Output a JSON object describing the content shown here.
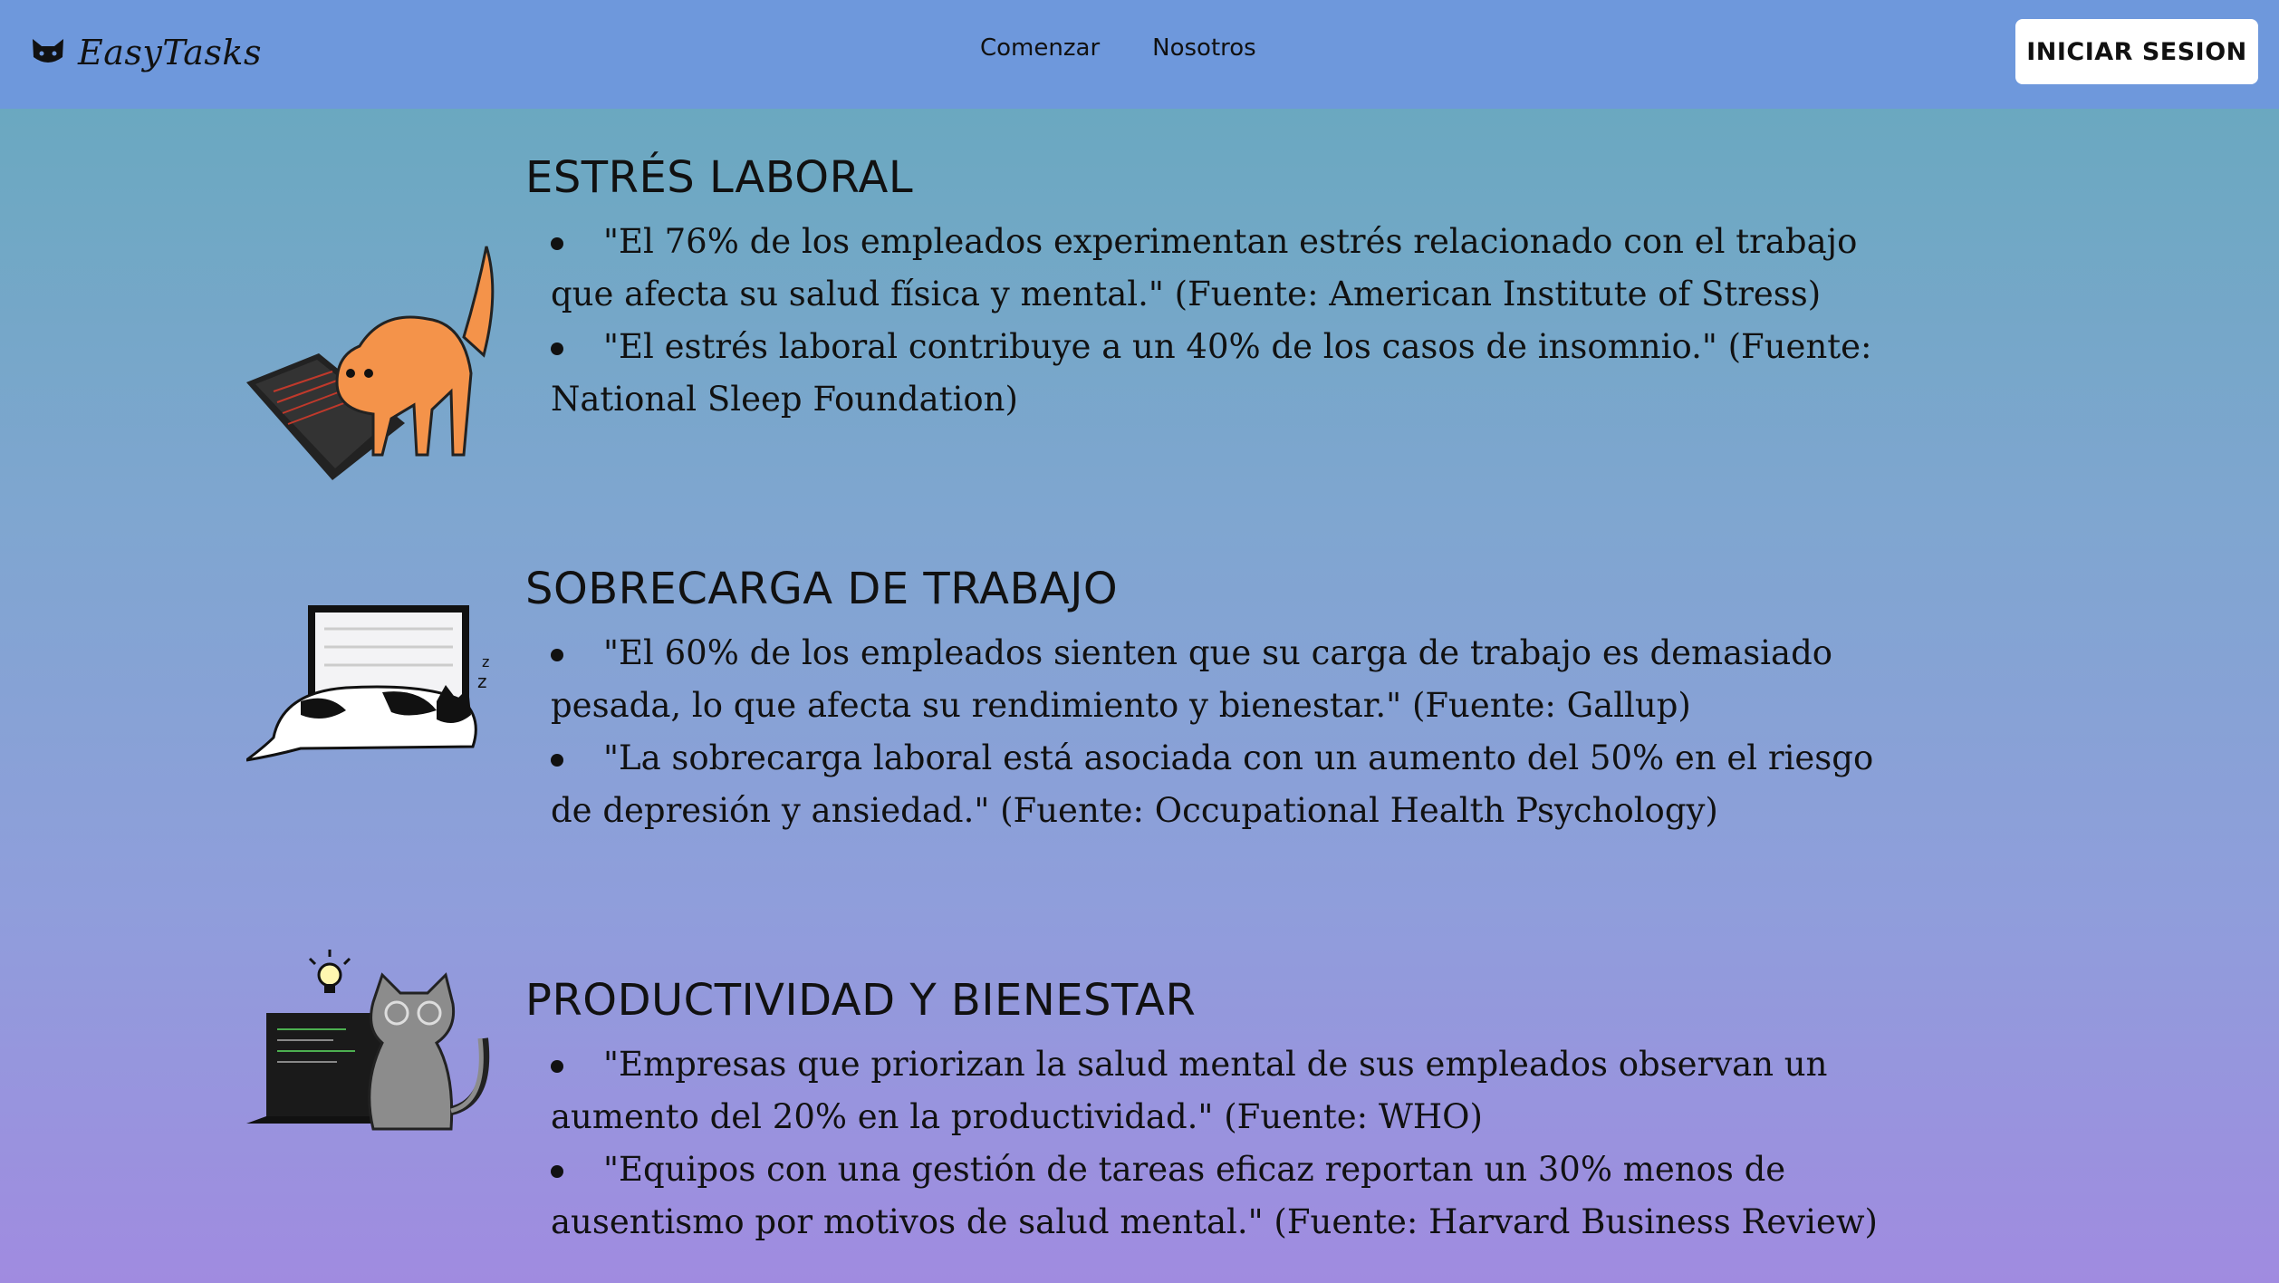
{
  "header": {
    "brand": "EasyTasks",
    "brand_icon": "cat-face-icon",
    "nav": [
      "Comenzar",
      "Nosotros"
    ],
    "login_label": "INICIAR SESION"
  },
  "sections": [
    {
      "title": "ESTRÉS LABORAL",
      "illustration": "angry-orange-cat-on-laptop",
      "items": [
        "\"El 76% de los empleados experimentan estrés relacionado con el trabajo que afecta su salud física y mental.\" (Fuente: American Institute of Stress)",
        "\"El estrés laboral contribuye a un 40% de los casos de insomnio.\" (Fuente: National Sleep Foundation)"
      ]
    },
    {
      "title": "SOBRECARGA DE TRABAJO",
      "illustration": "sleeping-cat-on-laptop",
      "items": [
        "\"El 60% de los empleados sienten que su carga de trabajo es demasiado pesada, lo que afecta su rendimiento y bienestar.\" (Fuente: Gallup)",
        "\"La sobrecarga laboral está asociada con un aumento del 50% en el riesgo de depresión y ansiedad.\" (Fuente: Occupational Health Psychology)"
      ]
    },
    {
      "title": "PRODUCTIVIDAD Y BIENESTAR",
      "illustration": "happy-grey-cat-with-laptop-and-lightbulb",
      "items": [
        "\"Empresas que priorizan la salud mental de sus empleados observan un aumento del 20% en la productividad.\" (Fuente: WHO)",
        "\"Equipos con una gestión de tareas eficaz reportan un 30% menos de ausentismo por motivos de salud mental.\" (Fuente: Harvard Business Review)"
      ]
    }
  ]
}
